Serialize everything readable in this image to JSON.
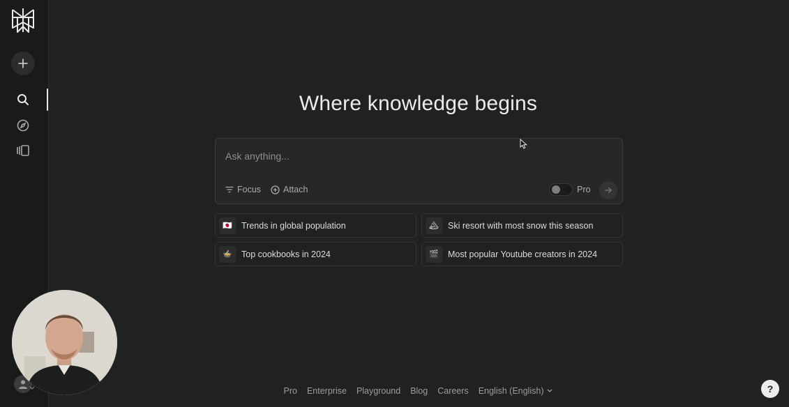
{
  "sidebar": {
    "logo_icon": "perplexity-logo-icon",
    "new_thread_icon": "plus-icon",
    "nav": [
      {
        "name": "search",
        "icon": "search-icon",
        "active": true
      },
      {
        "name": "discover",
        "icon": "compass-icon",
        "active": false
      },
      {
        "name": "library",
        "icon": "library-icon",
        "active": false
      }
    ],
    "account_icon": "user-icon"
  },
  "main": {
    "headline": "Where knowledge begins",
    "ask": {
      "placeholder": "Ask anything...",
      "value": "",
      "focus_label": "Focus",
      "attach_label": "Attach",
      "pro_label": "Pro",
      "pro_enabled": false
    },
    "suggestions": [
      {
        "emoji": "🇯🇵",
        "label": "Trends in global population"
      },
      {
        "emoji": "🏔",
        "label": "Ski resort with most snow this season"
      },
      {
        "emoji": "🍲",
        "label": "Top cookbooks in 2024"
      },
      {
        "emoji": "🎬",
        "label": "Most popular Youtube creators in 2024"
      }
    ]
  },
  "footer": {
    "links": [
      "Pro",
      "Enterprise",
      "Playground",
      "Blog",
      "Careers"
    ],
    "language": "English (English)",
    "help_label": "?"
  },
  "colors": {
    "background": "#202222",
    "sidebar": "#191a1a",
    "text": "#e8e8e6",
    "muted": "#9b9d9d"
  }
}
